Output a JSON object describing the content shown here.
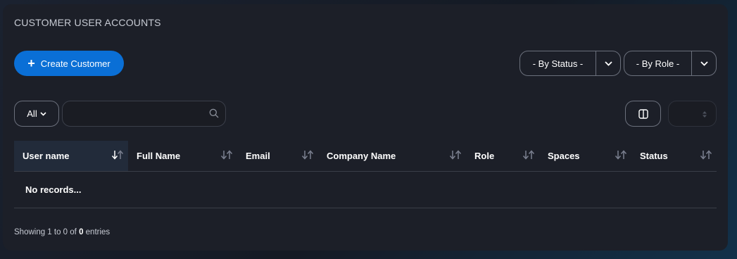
{
  "page": {
    "title": "CUSTOMER USER ACCOUNTS"
  },
  "toolbar": {
    "create_label": "Create Customer",
    "status_filter": "- By Status -",
    "role_filter": "- By Role -",
    "all_label": "All",
    "search": {
      "value": "",
      "placeholder": ""
    },
    "page_size": ""
  },
  "table": {
    "columns": [
      "User name",
      "Full Name",
      "Email",
      "Company Name",
      "Role",
      "Spaces",
      "Status"
    ],
    "sorted_column": "User name",
    "empty_message": "No records..."
  },
  "footer": {
    "showing_prefix": "Showing 1 to 0 of ",
    "total": "0",
    "suffix": " entries"
  },
  "colors": {
    "accent": "#0a6fd6",
    "card_bg": "#1c1f28",
    "border": "#6b707c",
    "active_header_bg": "#222b3a"
  },
  "icons": {
    "create": "plus-icon",
    "dropdown": "chevron-down-icon",
    "search": "search-icon",
    "columns": "columns-icon",
    "sort": "sort-arrows-icon",
    "spinner": "spinner-arrows-icon"
  }
}
